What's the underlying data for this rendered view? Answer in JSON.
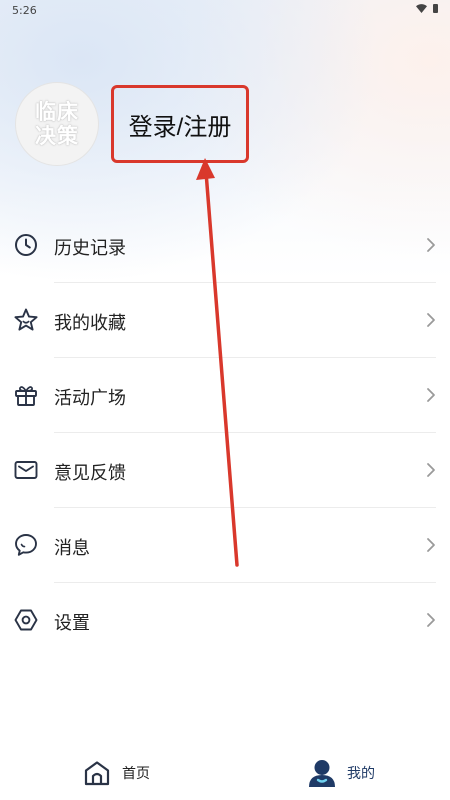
{
  "status_bar": {
    "time": "5:26",
    "icons": [
      "wifi-icon",
      "battery-icon"
    ]
  },
  "profile": {
    "avatar_text": "临床决策",
    "login_label": "登录/注册"
  },
  "menu": {
    "items": [
      {
        "label": "历史记录",
        "icon": "clock-icon"
      },
      {
        "label": "我的收藏",
        "icon": "star-icon"
      },
      {
        "label": "活动广场",
        "icon": "gift-icon"
      },
      {
        "label": "意见反馈",
        "icon": "mail-icon"
      },
      {
        "label": "消息",
        "icon": "chat-bubble-icon"
      },
      {
        "label": "设置",
        "icon": "settings-hexagon-icon"
      }
    ]
  },
  "tabbar": {
    "tabs": [
      {
        "label": "首页",
        "icon": "home-icon",
        "active": false
      },
      {
        "label": "我的",
        "icon": "user-icon",
        "active": true
      }
    ]
  },
  "colors": {
    "annotation": "#d9382c",
    "active_tab": "#1f3a66",
    "icon_dark": "#2a3346"
  }
}
